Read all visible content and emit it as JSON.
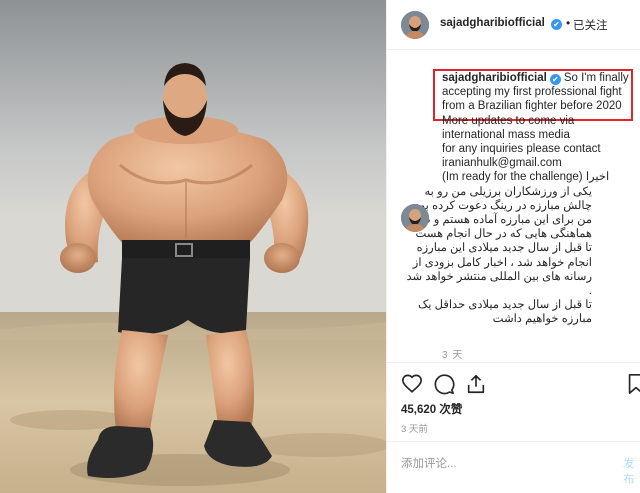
{
  "header": {
    "username": "sajadgharibiofficial",
    "verified_mark": "✔",
    "separator": "•",
    "follow_label": "已关注"
  },
  "caption": {
    "username": "sajadgharibiofficial",
    "lines": [
      "So I'm finally",
      "accepting my first professional fight",
      "from a Brazilian fighter before 2020",
      "More updates to come via",
      "international mass media",
      "for any inquiries please contact",
      "iranianhulk@gmail.com",
      "(Im ready for the challenge) اخیرا"
    ],
    "persian_lines": [
      "یکی از ورزشکاران برزیلی من رو به",
      "چالش مبارزه در رینگ دعوت کرده بود ،",
      "من برای این مبارزه آماده هستم و طبق",
      "هماهنگی هایی که در حال انجام هست",
      "تا قبل از سال جدید میلادی این مبارزه",
      "انجام خواهد شد ، اخبار کامل بزودی از",
      "رسانه های بین المللی منتشر خواهد شد",
      ".",
      "تا قبل از سال جدید میلادی حداقل یک",
      "مبارزه خواهیم داشت"
    ],
    "time": "3 天"
  },
  "icons": {
    "like": "heart-icon",
    "comment": "comment-icon",
    "share": "share-icon",
    "save": "bookmark-icon"
  },
  "likes": "45,620 次赞",
  "posted": "3 天前",
  "comment": {
    "placeholder": "添加评论...",
    "send_label": "发布"
  },
  "colors": {
    "highlight_box": "#e0242a",
    "verified": "#3897f0",
    "muted_text": "#999999"
  }
}
